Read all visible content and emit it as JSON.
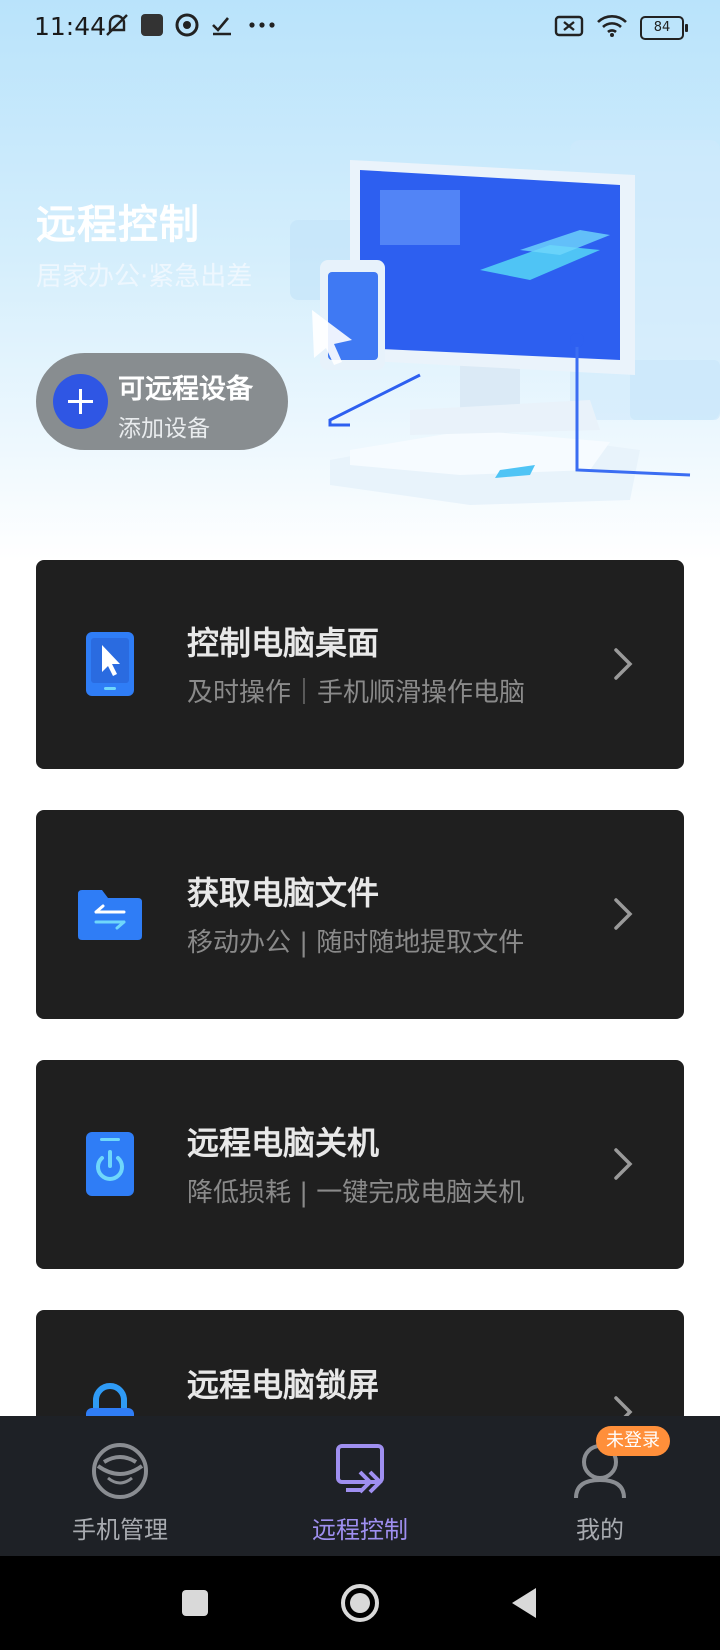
{
  "status_bar": {
    "time": "11:44",
    "left_icons": [
      "mute-icon",
      "app-square-icon",
      "eye-icon",
      "checkmark-icon",
      "more-icon"
    ],
    "right_icons": [
      "sim-off-icon",
      "wifi-icon"
    ],
    "battery": "84"
  },
  "hero": {
    "title": "远程控制",
    "subtitle": "居家办公·紧急出差",
    "add_device": {
      "title": "可远程设备",
      "subtitle": "添加设备"
    }
  },
  "cards": [
    {
      "title": "控制电脑桌面",
      "subtitle": "及时操作｜手机顺滑操作电脑",
      "icon": "cursor-device-icon"
    },
    {
      "title": "获取电脑文件",
      "subtitle": "移动办公 | 随时随地提取文件",
      "icon": "folder-transfer-icon"
    },
    {
      "title": "远程电脑关机",
      "subtitle": "降低损耗 | 一键完成电脑关机",
      "icon": "power-icon"
    },
    {
      "title": "远程电脑锁屏",
      "subtitle": "",
      "icon": "lock-icon"
    }
  ],
  "bottom_nav": {
    "items": [
      {
        "label": "手机管理",
        "icon": "phone-manage-icon",
        "active": false
      },
      {
        "label": "远程控制",
        "icon": "remote-control-icon",
        "active": true
      },
      {
        "label": "我的",
        "icon": "user-icon",
        "active": false
      }
    ],
    "badge": "未登录"
  },
  "colors": {
    "accent": "#2f56e4",
    "card_bg": "#1f1f1f",
    "nav_bg": "#1e2126",
    "nav_active": "#9f8ff0",
    "badge": "#ff8f3a"
  }
}
